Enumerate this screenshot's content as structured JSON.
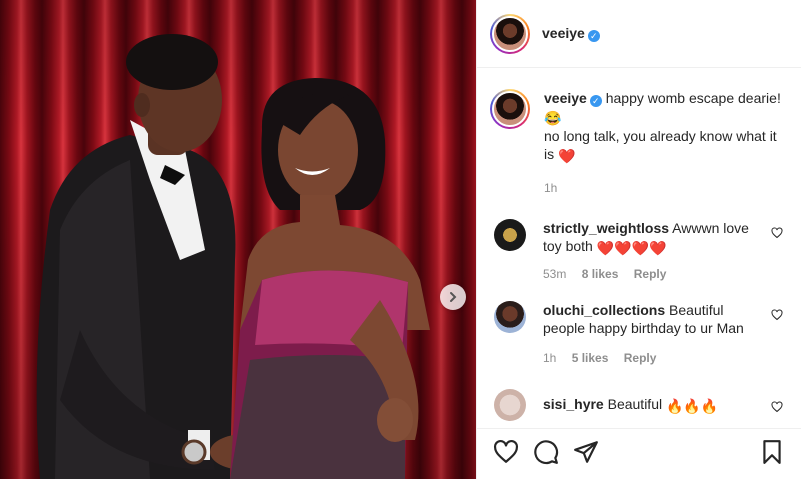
{
  "header": {
    "username": "veeiye",
    "verified_glyph": "✓"
  },
  "caption": {
    "username": "veeiye",
    "line1": "happy womb escape dearie!",
    "line2_emoji": "😂",
    "line3": "no long talk, you already know what it is",
    "line3_emoji": "❤️",
    "time": "1h"
  },
  "comments": [
    {
      "username": "strictly_weightloss",
      "text": "Awwwn love toy both",
      "emoji": "❤️❤️❤️❤️",
      "time": "53m",
      "likes": "8 likes",
      "reply": "Reply"
    },
    {
      "username": "oluchi_collections",
      "text": "Beautiful people happy birthday to ur Man",
      "emoji": "",
      "time": "1h",
      "likes": "5 likes",
      "reply": "Reply"
    },
    {
      "username": "sisi_hyre",
      "text": "Beautiful",
      "emoji": "🔥🔥🔥",
      "time": "",
      "likes": "",
      "reply": ""
    }
  ],
  "icons": {
    "like": "heart-icon",
    "comment": "comment-icon",
    "share": "paper-plane-icon",
    "save": "bookmark-icon",
    "next": "chevron-right-icon"
  },
  "colors": {
    "verified": "#3897f0",
    "text": "#262626",
    "meta": "#8e8e8e",
    "border": "#efefef",
    "curtain": "#a11520"
  }
}
